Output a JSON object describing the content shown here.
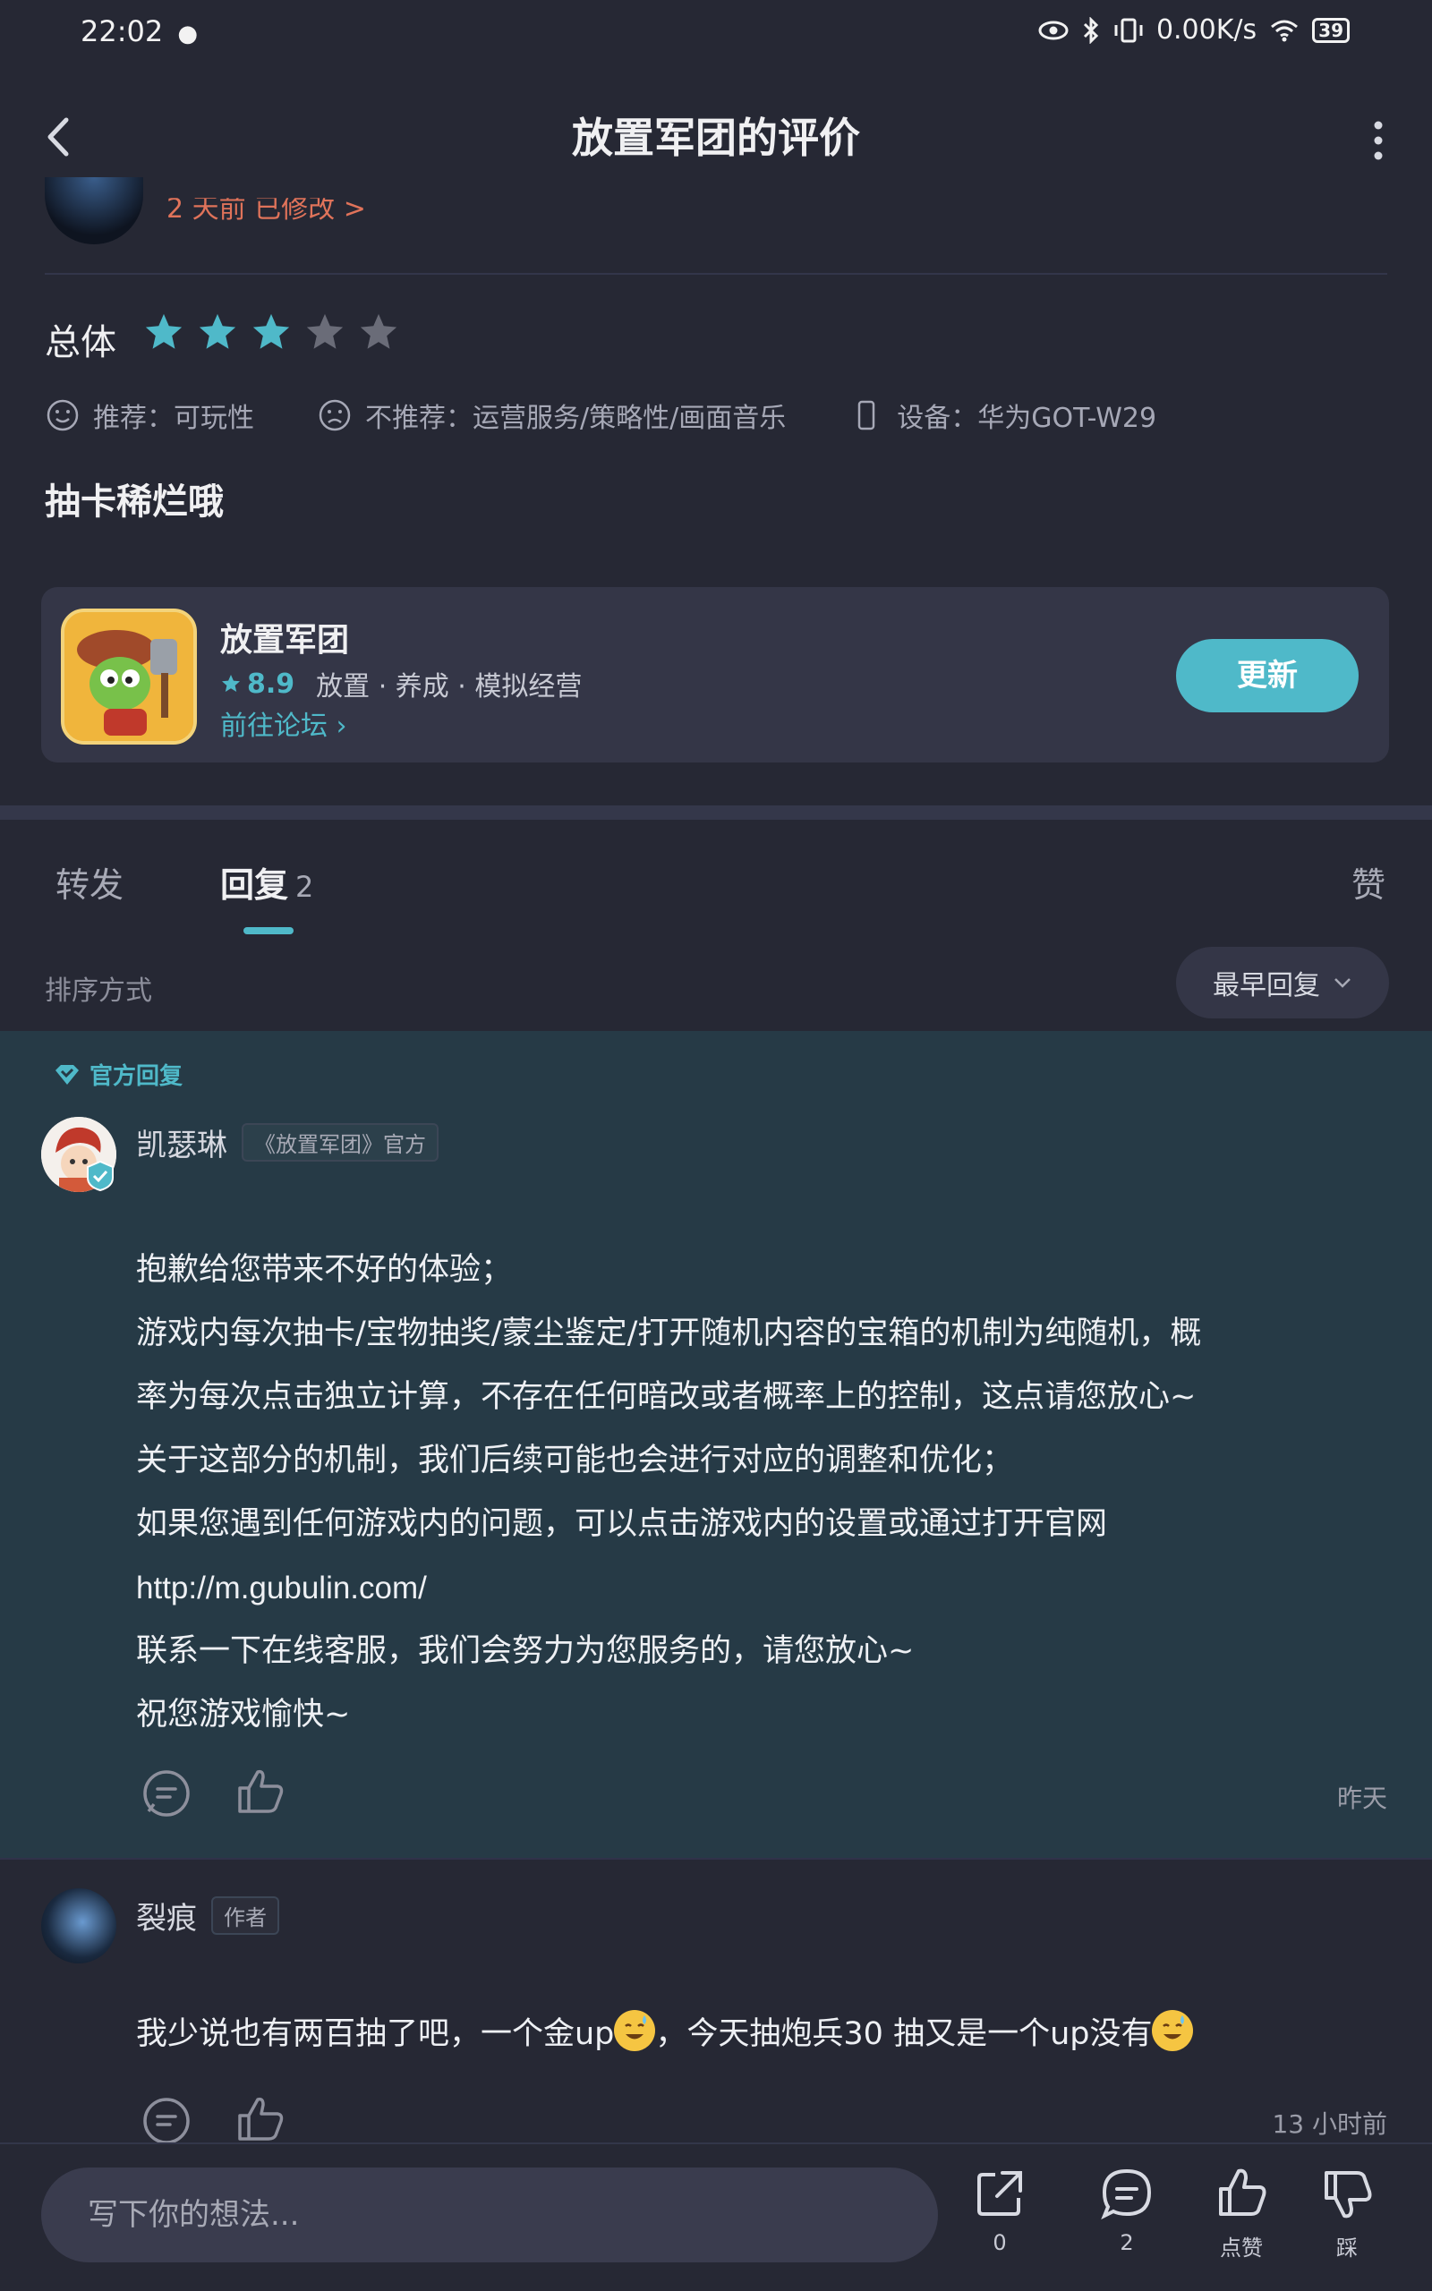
{
  "status_bar": {
    "time": "22:02",
    "net_speed": "0.00K/s",
    "battery": "39"
  },
  "header": {
    "title": "放置军团的评价"
  },
  "review": {
    "edited_note": "2 天前 已修改 >",
    "overall_label": "总体",
    "rating_stars": 3,
    "rating_max": 5,
    "recommend": "推荐：可玩性",
    "not_recommend": "不推荐：运营服务/策略性/画面音乐",
    "device": "设备：华为GOT-W29",
    "text": "抽卡稀烂哦"
  },
  "game_card": {
    "name": "放置军团",
    "rating": "8.9",
    "tags": "放置 · 养成 · 模拟经营",
    "forum_link": "前往论坛",
    "update_button": "更新"
  },
  "tabs": {
    "forward": "转发",
    "reply": "回复",
    "reply_count": "2",
    "like": "赞"
  },
  "sort": {
    "label": "排序方式",
    "selected": "最早回复"
  },
  "official_reply": {
    "tag": "官方回复",
    "username": "凯瑟琳",
    "badge": "《放置军团》官方",
    "lines": [
      "抱歉给您带来不好的体验；",
      "游戏内每次抽卡/宝物抽奖/蒙尘鉴定/打开随机内容的宝箱的机制为纯随机，概",
      "率为每次点击独立计算，不存在任何暗改或者概率上的控制，这点请您放心~",
      "关于这部分的机制，我们后续可能也会进行对应的调整和优化；",
      "如果您遇到任何游戏内的问题，可以点击游戏内的设置或通过打开官网",
      "http://m.gubulin.com/",
      "联系一下在线客服，我们会努力为您服务的，请您放心~",
      "祝您游戏愉快~"
    ],
    "time": "昨天"
  },
  "author_reply": {
    "username": "裂痕",
    "badge": "作者",
    "text_part1": "我少说也有两百抽了吧，一个金up",
    "text_part2": "，今天抽炮兵30 抽又是一个up没有",
    "time": "13 小时前"
  },
  "bottom_bar": {
    "input_placeholder": "写下你的想法...",
    "share_count": "0",
    "comment_count": "2",
    "like_label": "点赞",
    "dislike_label": "踩"
  },
  "colors": {
    "accent": "#4fb9c9",
    "background": "#262834",
    "official_bg": "#263a46",
    "edited": "#e0735a"
  }
}
